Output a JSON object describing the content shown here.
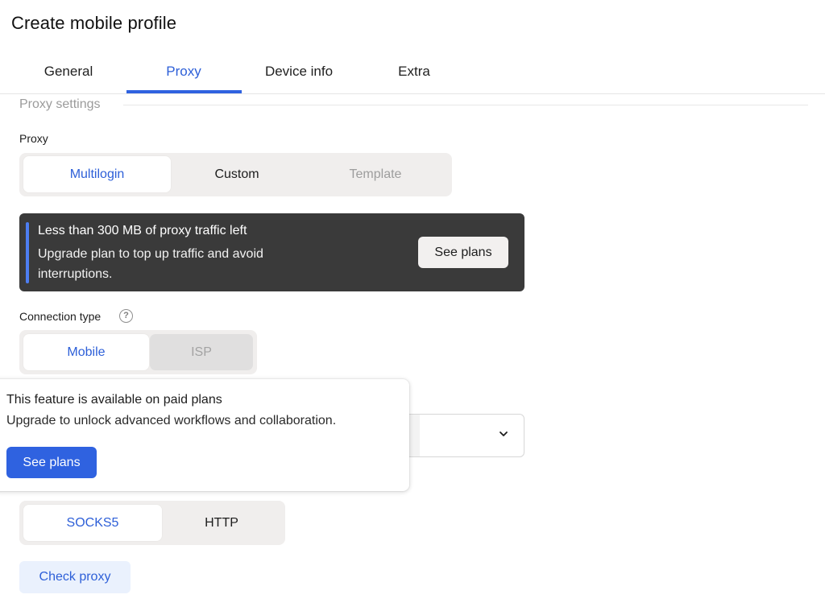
{
  "header": {
    "title": "Create mobile profile"
  },
  "tabs": [
    {
      "label": "General"
    },
    {
      "label": "Proxy",
      "active": true
    },
    {
      "label": "Device info"
    },
    {
      "label": "Extra"
    }
  ],
  "section": {
    "label": "Proxy settings"
  },
  "proxy": {
    "label": "Proxy",
    "options": [
      "Multilogin",
      "Custom",
      "Template"
    ],
    "selected": "Multilogin"
  },
  "banner": {
    "title": "Less than 300 MB of proxy traffic left",
    "text": "Upgrade plan to top up traffic and avoid interruptions.",
    "button": "See plans"
  },
  "connection": {
    "label": "Connection type",
    "options": [
      "Mobile",
      "ISP"
    ],
    "selected": "Mobile"
  },
  "popover": {
    "title": "This feature is available on paid plans",
    "text": "Upgrade to unlock advanced workflows and collaboration.",
    "button": "See plans"
  },
  "protocol": {
    "options": [
      "SOCKS5",
      "HTTP"
    ],
    "selected": "SOCKS5"
  },
  "actions": {
    "check_proxy": "Check proxy"
  },
  "icons": {
    "help": "question-circle-icon",
    "chevron": "chevron-down-icon"
  },
  "colors": {
    "accent": "#2f62e0",
    "banner_bg": "#3a3a3a",
    "banner_bar": "#4d7ef2"
  }
}
